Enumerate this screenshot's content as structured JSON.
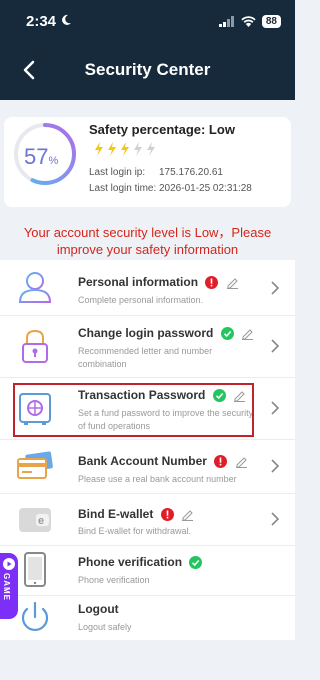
{
  "statusbar": {
    "time": "2:34",
    "battery": "88"
  },
  "header": {
    "title": "Security Center"
  },
  "safety": {
    "percent": "57",
    "percent_sign": "%",
    "label": "Safety percentage: Low",
    "level_filled": 3,
    "level_total": 5,
    "last_ip_label": "Last login ip:",
    "last_ip": "175.176.20.61",
    "last_time_label": "Last login time:",
    "last_time": "2026-01-25 02:31:28"
  },
  "warning": {
    "line1": "Your account security level is Low，Please",
    "line2": "improve your safety information"
  },
  "items": [
    {
      "name": "Personal information",
      "desc": "Complete personal information.",
      "status": "incomplete"
    },
    {
      "name": "Change login password",
      "desc": "Recommended letter and number combination",
      "status": "complete"
    },
    {
      "name": "Transaction Password",
      "desc": "Set a fund password to improve the security of fund operations",
      "status": "complete"
    },
    {
      "name": "Bank Account Number",
      "desc": "Please use a real bank account number",
      "status": "incomplete"
    },
    {
      "name": "Bind E-wallet",
      "desc": "Bind E-wallet for withdrawal.",
      "status": "incomplete"
    },
    {
      "name": "Phone verification",
      "desc": "Phone verification",
      "status": "complete"
    },
    {
      "name": "Logout",
      "desc": "Logout safely",
      "status": ""
    }
  ],
  "game_tab": {
    "label": "GAME"
  },
  "colors": {
    "header_bg": "#162a3c",
    "accent": "#7b2ff7",
    "warning": "#d4261c",
    "ok": "#22c55e",
    "alert": "#e11d2a"
  }
}
